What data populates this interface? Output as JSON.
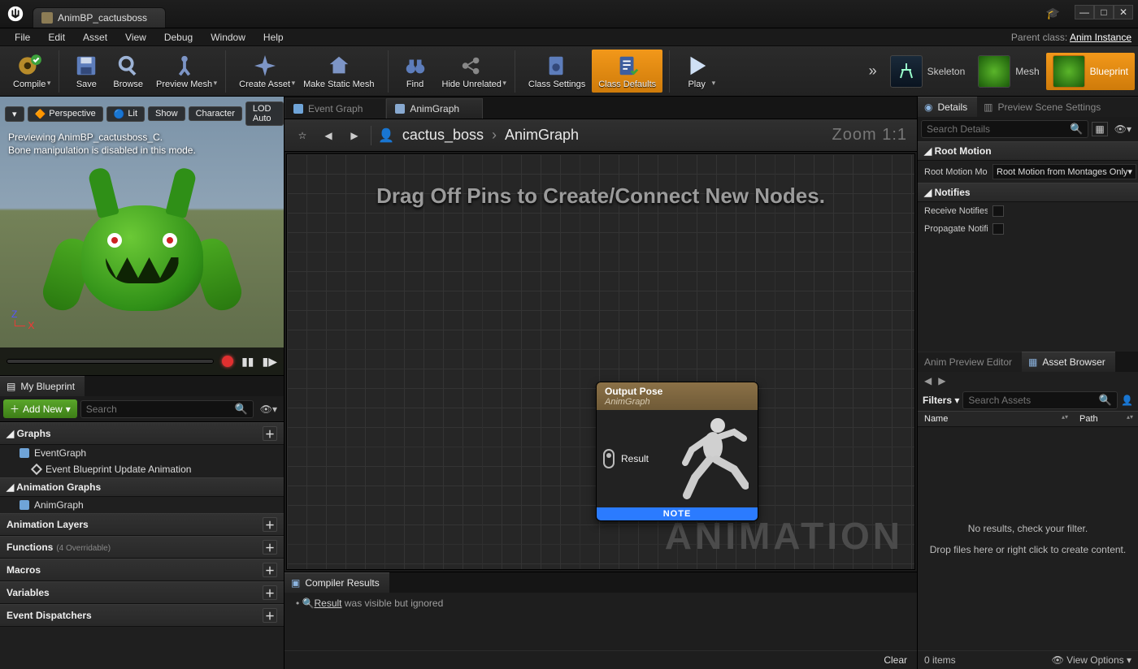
{
  "titlebar": {
    "doc_title": "AnimBP_cactusboss"
  },
  "menu": {
    "items": [
      "File",
      "Edit",
      "Asset",
      "View",
      "Debug",
      "Window",
      "Help"
    ],
    "parent_label": "Parent class:",
    "parent_value": "Anim Instance"
  },
  "toolbar": {
    "compile": "Compile",
    "save": "Save",
    "browse": "Browse",
    "preview_mesh": "Preview Mesh",
    "create_asset": "Create Asset",
    "make_static": "Make Static Mesh",
    "find": "Find",
    "hide_unrelated": "Hide Unrelated",
    "class_settings": "Class Settings",
    "class_defaults": "Class Defaults",
    "play": "Play",
    "mode_skeleton": "Skeleton",
    "mode_mesh": "Mesh",
    "mode_blueprint": "Blueprint"
  },
  "viewport": {
    "perspective": "Perspective",
    "lit": "Lit",
    "show": "Show",
    "character": "Character",
    "lod": "LOD Auto",
    "hint1": "Previewing AnimBP_cactusboss_C.",
    "hint2": "Bone manipulation is disabled in this mode."
  },
  "mybp": {
    "tab": "My Blueprint",
    "addnew": "Add New",
    "search_ph": "Search",
    "cat_graphs": "Graphs",
    "item_eventgraph": "EventGraph",
    "item_event_update": "Event Blueprint Update Animation",
    "cat_animgraphs": "Animation Graphs",
    "item_animgraph": "AnimGraph",
    "cat_animlayers": "Animation Layers",
    "cat_functions": "Functions",
    "functions_sub": "(4 Overridable)",
    "cat_macros": "Macros",
    "cat_variables": "Variables",
    "cat_dispatch": "Event Dispatchers"
  },
  "graph": {
    "tab_event": "Event Graph",
    "tab_anim": "AnimGraph",
    "bc_root": "cactus_boss",
    "bc_leaf": "AnimGraph",
    "zoom": "Zoom 1:1",
    "hint": "Drag Off Pins to Create/Connect New Nodes.",
    "watermark": "ANIMATION",
    "node_title": "Output Pose",
    "node_sub": "AnimGraph",
    "node_pin": "Result",
    "node_foot": "NOTE"
  },
  "compiler": {
    "tab": "Compiler Results",
    "msg_link": "Result",
    "msg_rest": "  was visible but ignored",
    "clear": "Clear"
  },
  "details": {
    "tab_details": "Details",
    "tab_preview": "Preview Scene Settings",
    "search_ph": "Search Details",
    "cat_root": "Root Motion",
    "row_rootmode": "Root Motion Mode",
    "val_rootmode": "Root Motion from Montages Only",
    "cat_notifies": "Notifies",
    "row_receive": "Receive Notifies",
    "row_propagate": "Propagate Notifies to Linked Anim Instances"
  },
  "asset": {
    "tab_preview": "Anim Preview Editor",
    "tab_browser": "Asset Browser",
    "filters": "Filters",
    "search_ph": "Search Assets",
    "col_name": "Name",
    "col_path": "Path",
    "empty1": "No results, check your filter.",
    "empty2": "Drop files here or right click to create content.",
    "items": "0 items",
    "viewopts": "View Options"
  }
}
